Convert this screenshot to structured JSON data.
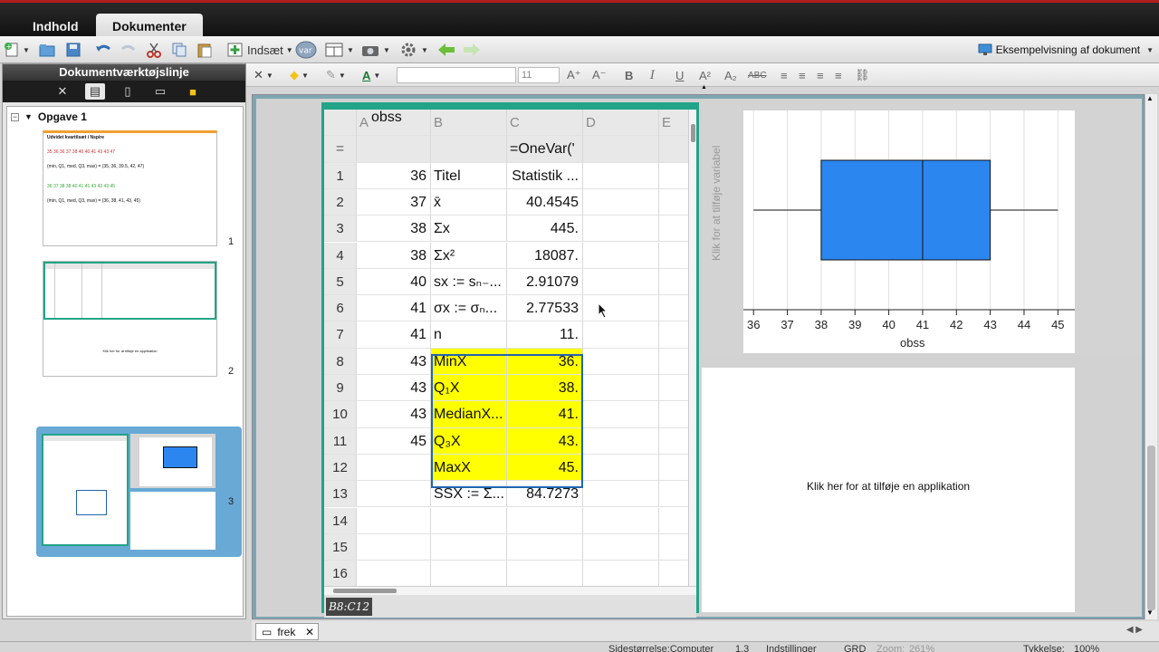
{
  "tabs": [
    {
      "label": "Indhold"
    },
    {
      "label": "Dokumenter"
    }
  ],
  "toolbar": {
    "insert_label": "Indsæt",
    "var_label": "var",
    "preview_label": "Eksempelvisning af dokument"
  },
  "sidebar": {
    "title": "Dokumentværktøjslinje",
    "problem_label": "Opgave 1",
    "pages": [
      {
        "number": "1"
      },
      {
        "number": "2"
      },
      {
        "number": "3"
      }
    ],
    "thumb1": {
      "title": "Udvidet kvartilsæt i Nspire",
      "line1": "35 36 36 37 38 40 40 41 43 43 47",
      "line2": "(min, Q1, med, Q3, max) = (35, 36, 39.5, 42, 47)",
      "line3": "36 37 38 38 40 41 41 43 43 43 45",
      "line4": "(min, Q1, med, Q3, max) = (36, 38, 41, 43, 45)"
    },
    "thumb2": {
      "hint": "Klik her for at tilføje en applikation"
    }
  },
  "format": {
    "font_size": "11"
  },
  "sheet": {
    "columns": [
      "A",
      "B",
      "C",
      "D",
      "E"
    ],
    "a_header": "obss",
    "formula_row_label": "=",
    "formula": "=OneVar('",
    "rows": [
      {
        "n": "1",
        "a": "36",
        "b": "Titel",
        "c": "Statistik ..."
      },
      {
        "n": "2",
        "a": "37",
        "b": "x̄",
        "c": "40.4545"
      },
      {
        "n": "3",
        "a": "38",
        "b": "Σx",
        "c": "445."
      },
      {
        "n": "4",
        "a": "38",
        "b": "Σx²",
        "c": "18087."
      },
      {
        "n": "5",
        "a": "40",
        "b": "sx := sₙ₋...",
        "c": "2.91079"
      },
      {
        "n": "6",
        "a": "41",
        "b": "σx := σₙ...",
        "c": "2.77533"
      },
      {
        "n": "7",
        "a": "41",
        "b": "n",
        "c": "11."
      },
      {
        "n": "8",
        "a": "43",
        "b": "MinX",
        "c": "36."
      },
      {
        "n": "9",
        "a": "43",
        "b": "Q₁X",
        "c": "38."
      },
      {
        "n": "10",
        "a": "43",
        "b": "MedianX...",
        "c": "41."
      },
      {
        "n": "11",
        "a": "45",
        "b": "Q₃X",
        "c": "43."
      },
      {
        "n": "12",
        "a": "",
        "b": "MaxX",
        "c": "45."
      },
      {
        "n": "13",
        "a": "",
        "b": "SSX := Σ...",
        "c": "84.7273"
      },
      {
        "n": "14",
        "a": "",
        "b": "",
        "c": ""
      },
      {
        "n": "15",
        "a": "",
        "b": "",
        "c": ""
      },
      {
        "n": "16",
        "a": "",
        "b": "",
        "c": ""
      }
    ],
    "selection_ref": "B8:C12"
  },
  "plot": {
    "y_hint": "Klik for at tilføje variabel",
    "xlabel": "obss",
    "ticks": [
      "36",
      "37",
      "38",
      "39",
      "40",
      "41",
      "42",
      "43",
      "44",
      "45"
    ]
  },
  "chart_data": {
    "type": "boxplot",
    "xlabel": "obss",
    "xlim": [
      35.7,
      45.5
    ],
    "min": 36,
    "q1": 38,
    "median": 41,
    "q3": 43,
    "max": 45,
    "box_color": "#2b86f0"
  },
  "app_pane": {
    "hint": "Klik her for at tilføje en applikation"
  },
  "bottom": {
    "doc_tab": "frek",
    "status_page_size": "Sidestørrelse:Computer",
    "status_page": "1.3",
    "status_settings": "Indstillinger",
    "status_mode": "GRD",
    "status_zoom_label": "Zoom:",
    "status_zoom_value": "261%",
    "status_thickness_label": "Tykkelse:",
    "status_thickness_value": "100%"
  }
}
